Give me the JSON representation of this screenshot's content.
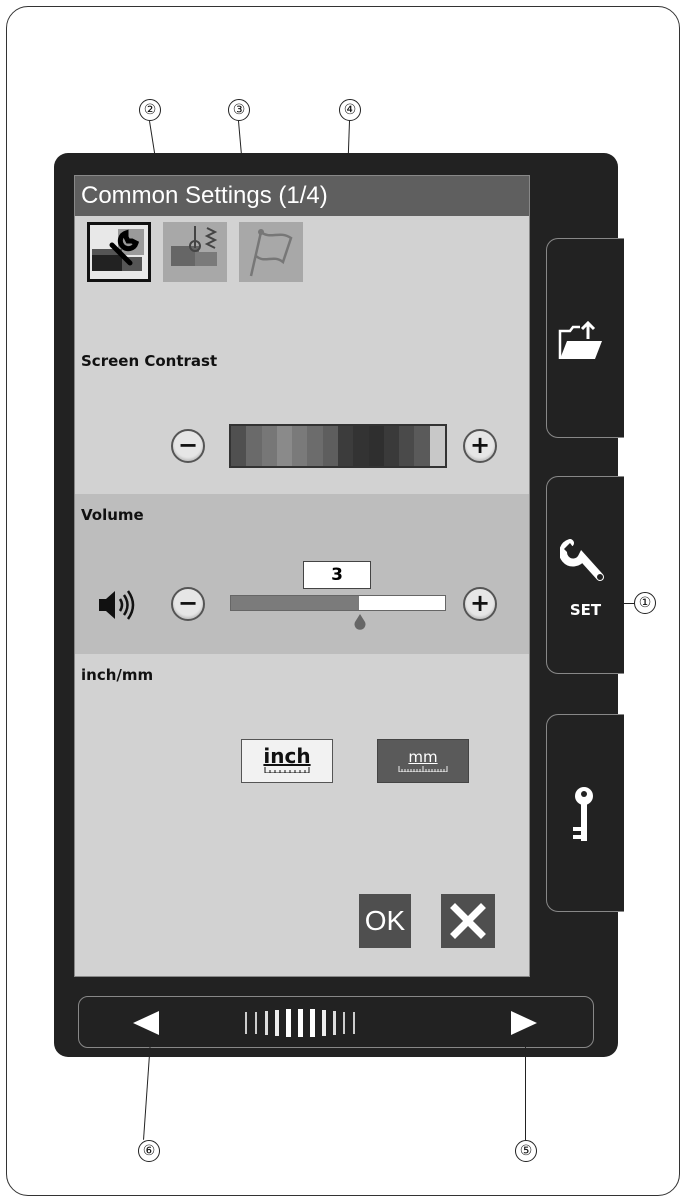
{
  "screen": {
    "title": "Common Settings (1/4)",
    "tabs": [
      {
        "name": "machine-settings",
        "icon": "wrench-machine-icon",
        "active": true
      },
      {
        "name": "sewing-settings",
        "icon": "needle-stitch-icon",
        "active": false
      },
      {
        "name": "language-settings",
        "icon": "flag-icon",
        "active": false
      }
    ],
    "contrast": {
      "label": "Screen Contrast",
      "minus": "−",
      "plus": "+",
      "swatches": [
        "#505050",
        "#6a6a6a",
        "#777",
        "#8a8a8a",
        "#7a7a7a",
        "#6c6c6c",
        "#5e5e5e",
        "#3c3c3c",
        "#333",
        "#2f2f2f",
        "#3a3a3a",
        "#4a4a4a",
        "#5a5a5a",
        "#c8c8c8"
      ]
    },
    "volume": {
      "label": "Volume",
      "value": "3",
      "level_fraction": 0.6,
      "minus": "−",
      "plus": "+",
      "speaker_icon": "speaker-icon"
    },
    "units": {
      "label": "inch/mm",
      "inch_label": "inch",
      "mm_label": "mm",
      "selected": "inch"
    },
    "ok_label": "OK",
    "close_icon": "close-x-icon"
  },
  "side_buttons": [
    {
      "name": "file-open",
      "icon": "folder-upload-icon",
      "label": ""
    },
    {
      "name": "settings",
      "icon": "wrench-icon",
      "label": "SET"
    },
    {
      "name": "lock",
      "icon": "key-icon",
      "label": ""
    }
  ],
  "nav": {
    "prev_icon": "left-arrow-icon",
    "next_icon": "right-arrow-icon",
    "page_indicator_icon": "page-indicator-icon"
  },
  "callouts": [
    "①",
    "②",
    "③",
    "④",
    "⑤",
    "⑥"
  ]
}
